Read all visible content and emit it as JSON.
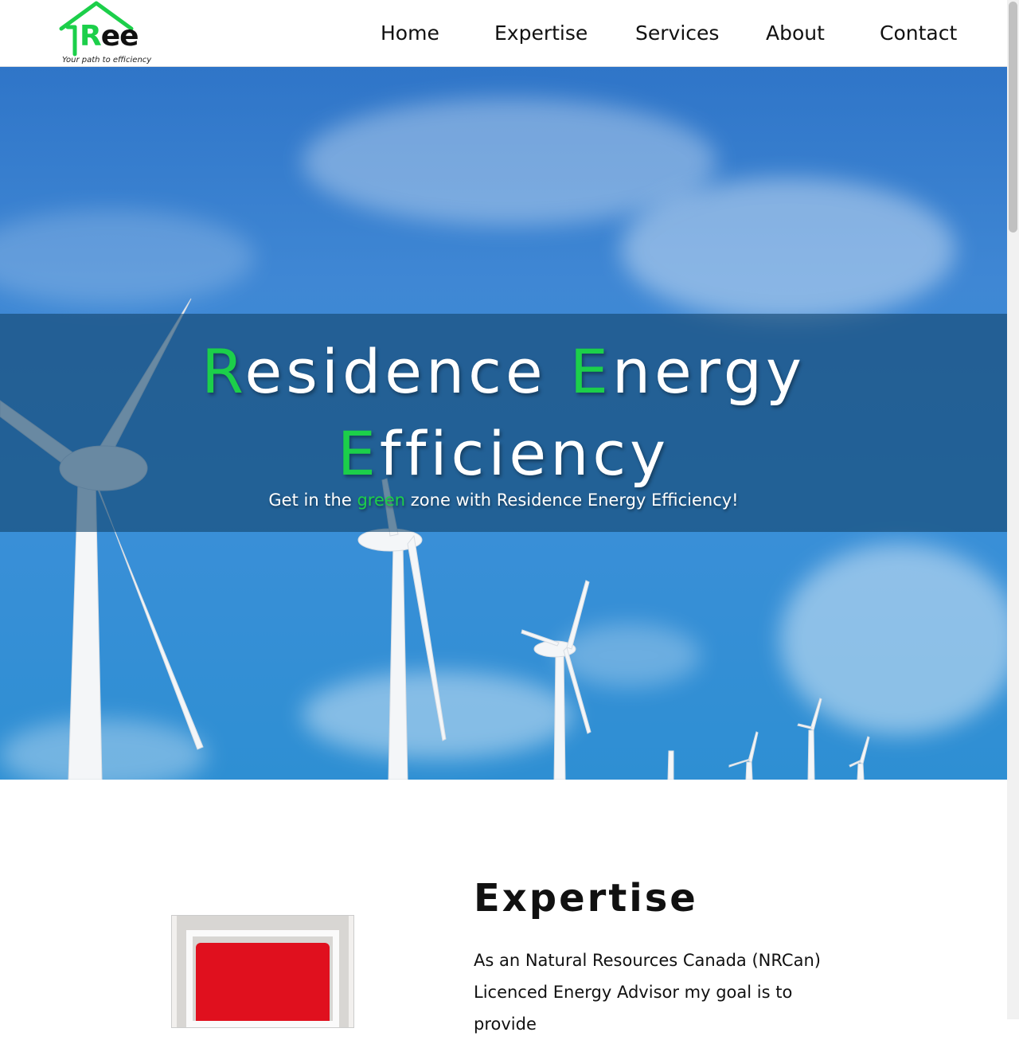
{
  "logo": {
    "letter_r": "R",
    "letters_ee": "ee",
    "tagline": "Your path to efficiency",
    "icon": "house-roof-icon"
  },
  "nav": {
    "items": [
      "Home",
      "Expertise",
      "Services",
      "About",
      "Contact"
    ]
  },
  "hero": {
    "title_line1": {
      "a_green": "R",
      "a_rest": "esidence ",
      "b_green": "E",
      "b_rest": "nergy"
    },
    "title_line2": {
      "green": "E",
      "rest": "fficiency"
    },
    "subtitle": {
      "before": "Get in the ",
      "green": "green",
      "after": " zone with Residence Energy Efficiency!"
    }
  },
  "expertise": {
    "title": "Expertise",
    "body": "As an Natural Resources Canada (NRCan) Licenced Energy Advisor my goal is to provide"
  },
  "colors": {
    "accent": "#1ccf4a",
    "sky": "#3b8fd8"
  }
}
